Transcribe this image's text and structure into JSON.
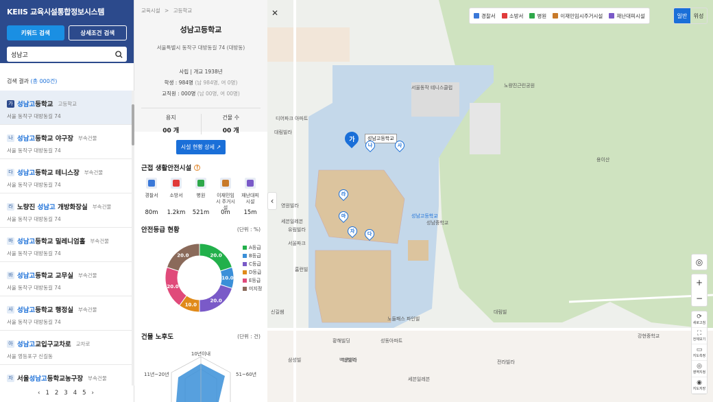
{
  "app_title": "KEIIS 교육시설통합정보시스템",
  "tabs": {
    "keyword": "키워드 검색",
    "detail": "상세조건 검색"
  },
  "search": {
    "value": "성남고",
    "icon": "search-icon"
  },
  "results": {
    "label": "검색 결과",
    "count_prefix": "(총 ",
    "count": "000건",
    "count_suffix": ")"
  },
  "items": [
    {
      "badge": "가",
      "pre": "",
      "hl": "성남고",
      "post": "등학교",
      "type": "고등학교",
      "addr": "서울 동작구 대방동길 74"
    },
    {
      "badge": "나",
      "pre": "",
      "hl": "성남고",
      "post": "등학교 야구장",
      "type": "부속건물",
      "addr": "서울 동작구 대방동길 74"
    },
    {
      "badge": "다",
      "pre": "",
      "hl": "성남고",
      "post": "등학교 테니스장",
      "type": "부속건물",
      "addr": "서울 동작구 대방동길 74"
    },
    {
      "badge": "라",
      "pre": "노량진 ",
      "hl": "성남고",
      "post": " 개방화장실",
      "type": "부속건물",
      "addr": "서울 동작구 대방동길 74"
    },
    {
      "badge": "마",
      "pre": "",
      "hl": "성남고",
      "post": "등학교 밀레니엄홀",
      "type": "부속건물",
      "addr": "서울 동작구 대방동길 74"
    },
    {
      "badge": "바",
      "pre": "",
      "hl": "성남고",
      "post": "등학교 교무실",
      "type": "부속건물",
      "addr": "서울 동작구 대방동길 74"
    },
    {
      "badge": "사",
      "pre": "",
      "hl": "성남고",
      "post": "등학교 행정실",
      "type": "부속건물",
      "addr": "서울 동작구 대방동길 74"
    },
    {
      "badge": "아",
      "pre": "",
      "hl": "성남고",
      "post": "교입구교차로",
      "type": "교차로",
      "addr": "서울 영등포구 신길동"
    },
    {
      "badge": "자",
      "pre": "서울",
      "hl": "성남고",
      "post": "등학교농구장",
      "type": "부속건물",
      "addr": ""
    }
  ],
  "pager": [
    "1",
    "2",
    "3",
    "4",
    "5"
  ],
  "detail": {
    "breadcrumb": [
      "교육시설",
      ">",
      "고등학교"
    ],
    "name": "성남고등학교",
    "address": "서울특별시 동작구 대방동길 74 (대방동)",
    "founded": "사립 | 개교 1938년",
    "students_label": "학생 : 984명",
    "students_sub": "(남 984명, 여 0명)",
    "staff_label": "교직원 : 000명",
    "staff_sub": "(남 00명, 여 00명)",
    "land_label": "용지",
    "land_val": "00 개",
    "bld_label": "건물 수",
    "bld_val": "00 개",
    "btn": "시설 현황 상세"
  },
  "nearby": {
    "title": "근접 생활안전시설",
    "items": [
      {
        "label": "경찰서",
        "dist": "80m",
        "color": "#3a78d8",
        "icon": "police-icon"
      },
      {
        "label": "소방서",
        "dist": "1.2km",
        "color": "#e03a3a",
        "icon": "fire-station-icon"
      },
      {
        "label": "병원",
        "dist": "521m",
        "color": "#2ea84a",
        "icon": "hospital-icon"
      },
      {
        "label": "이재민임시 주거시설",
        "dist": "0m",
        "color": "#c87a2a",
        "icon": "shelter-icon"
      },
      {
        "label": "재난대피 시설",
        "dist": "15m",
        "color": "#7a5ac8",
        "icon": "evacuation-icon"
      }
    ]
  },
  "safety": {
    "title": "안전등급 현황",
    "unit": "(단위 : %)"
  },
  "chart_data": [
    {
      "type": "pie",
      "title": "안전등급 현황",
      "unit": "(단위 : %)",
      "categories": [
        "A등급",
        "B등급",
        "C등급",
        "D등급",
        "E등급",
        "미지정"
      ],
      "values": [
        20,
        10,
        20,
        10,
        20,
        20
      ],
      "colors": [
        "#22b04b",
        "#3a8fd8",
        "#7a5ac8",
        "#e08a1a",
        "#e04a7a",
        "#8a6a5a"
      ]
    },
    {
      "type": "radar",
      "title": "건물 노후도",
      "unit": "(단위 : 건)",
      "categories": [
        "10년이내",
        "51~60년",
        "11년~20년"
      ]
    }
  ],
  "aging": {
    "title": "건물 노후도",
    "unit": "(단위 : 건)"
  },
  "map": {
    "legend": [
      {
        "label": "경찰서",
        "color": "#3a78d8"
      },
      {
        "label": "소방서",
        "color": "#e03a3a"
      },
      {
        "label": "병원",
        "color": "#2ea84a"
      },
      {
        "label": "이재민임시주거시설",
        "color": "#c87a2a"
      },
      {
        "label": "재난대피시설",
        "color": "#7a5ac8"
      }
    ],
    "mode": [
      "일반",
      "위성"
    ],
    "tools": [
      {
        "label": "새로고침",
        "icon": "refresh-icon"
      },
      {
        "label": "전체보기",
        "icon": "fullscreen-icon"
      },
      {
        "label": "지도측정",
        "icon": "ruler-icon"
      },
      {
        "label": "영역지정",
        "icon": "area-icon"
      },
      {
        "label": "지도저장",
        "icon": "camera-icon"
      }
    ],
    "labels": [
      "성남고등학교",
      "성남고등학교",
      "서울동작 테니스클럽",
      "노량진근린공원",
      "대림빌라",
      "디어파크 아파트",
      "영원빌라",
      "유림빌라",
      "홈런빌",
      "세븐일레븐",
      "서울파크",
      "신길쌤",
      "대방역",
      "황해빌딩",
      "노들패스 파인빌",
      "성동아파트",
      "세븐일레븐",
      "용이산",
      "성남중학교",
      "강현중학교",
      "벽산빌라",
      "전라빌라",
      "대림빌",
      "삼성빌"
    ],
    "pins": [
      "가",
      "나",
      "다",
      "라",
      "마",
      "사",
      "자"
    ]
  }
}
